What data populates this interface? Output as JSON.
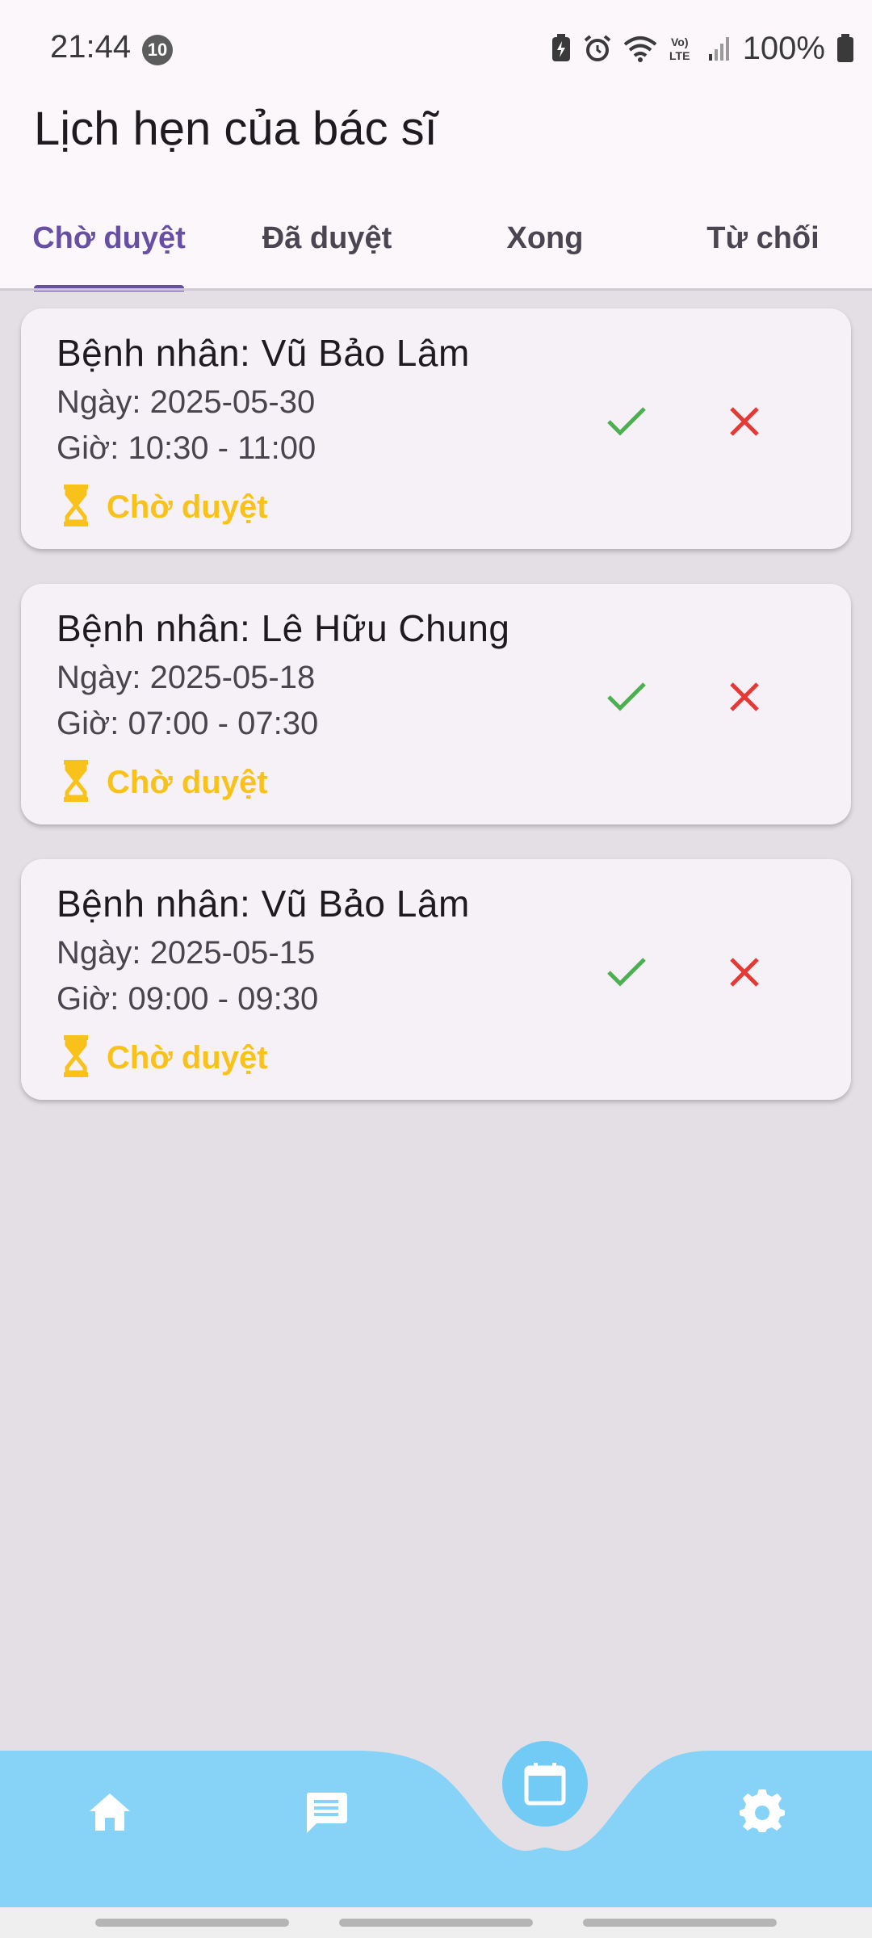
{
  "status_bar": {
    "time": "21:44",
    "notification_count": "10",
    "battery": "100%",
    "icons": [
      "battery-saver-icon",
      "alarm-icon",
      "wifi-icon",
      "volte-icon",
      "signal-icon",
      "battery-icon"
    ]
  },
  "header": {
    "title": "Lịch hẹn của bác sĩ"
  },
  "tabs": [
    {
      "label": "Chờ duyệt",
      "active": true
    },
    {
      "label": "Đã duyệt",
      "active": false
    },
    {
      "label": "Xong",
      "active": false
    },
    {
      "label": "Từ chối",
      "active": false
    }
  ],
  "appointments": [
    {
      "patient": "Bệnh nhân: Vũ Bảo Lâm",
      "date": "Ngày: 2025-05-30",
      "time": "Giờ: 10:30 - 11:00",
      "status": "Chờ duyệt"
    },
    {
      "patient": "Bệnh nhân: Lê Hữu Chung",
      "date": "Ngày: 2025-05-18",
      "time": "Giờ: 07:00 - 07:30",
      "status": "Chờ duyệt"
    },
    {
      "patient": "Bệnh nhân: Vũ Bảo Lâm",
      "date": "Ngày: 2025-05-15",
      "time": "Giờ: 09:00 - 09:30",
      "status": "Chờ duyệt"
    }
  ],
  "bottom_nav": {
    "items": [
      "home-icon",
      "chat-icon",
      "calendar-icon",
      "settings-icon"
    ],
    "selected": "calendar-icon"
  },
  "colors": {
    "accent": "#6750a4",
    "pending": "#f9c21a",
    "approve": "#4caf50",
    "reject": "#e53935",
    "nav_bar": "#86d3f7"
  }
}
